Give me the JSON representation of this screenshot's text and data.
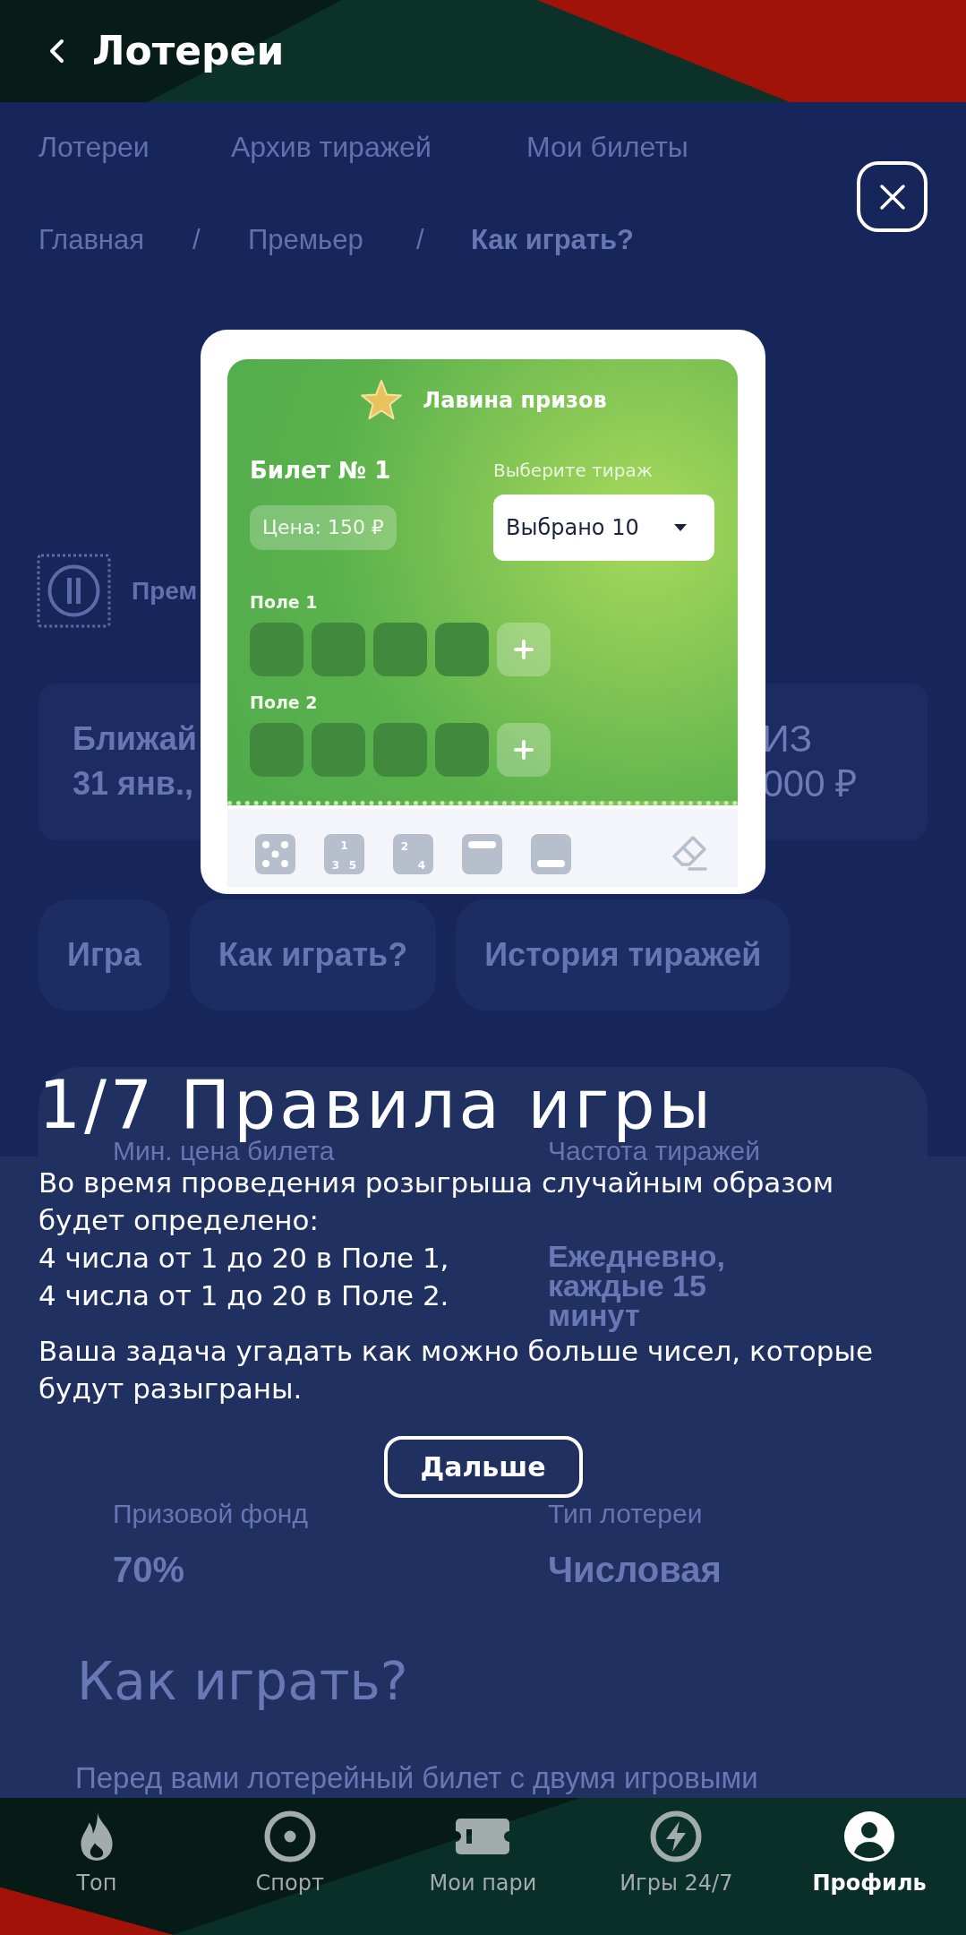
{
  "header": {
    "title": "Лотереи"
  },
  "section_tabs": [
    {
      "label": "Лотереи"
    },
    {
      "label": "Архив тиражей"
    },
    {
      "label": "Мои билеты"
    }
  ],
  "breadcrumbs": [
    {
      "kind": "link",
      "text": "Главная"
    },
    {
      "kind": "separator",
      "text": "/"
    },
    {
      "kind": "link",
      "text": "Премьер"
    },
    {
      "kind": "separator",
      "text": "/"
    },
    {
      "kind": "current",
      "text": "Как играть?"
    }
  ],
  "lottery": {
    "name": "Прем"
  },
  "info_cards": [
    {
      "label": "Ближай",
      "value": "31 янв.,"
    },
    {
      "label": "ИЗ",
      "value": "000 ₽"
    }
  ],
  "page_tabs": [
    {
      "label": "Игра"
    },
    {
      "label": "Как играть?"
    },
    {
      "label": "История тиражей"
    }
  ],
  "stats": [
    {
      "label": "Мин. цена билета"
    },
    {
      "label": "Частота тиражей",
      "value": "Ежедневно, каждые 15 минут"
    },
    {
      "label": "Призовой фонд",
      "value": "70%"
    },
    {
      "label": "Тип лотереи",
      "value": "Числовая"
    }
  ],
  "how_to_play": {
    "title": "Как играть?",
    "text": "Перед вами лотерейный билет с двумя игровыми"
  },
  "ticket": {
    "title": "Лавина призов",
    "number": "Билет № 1",
    "price": "Цена: 150 ₽",
    "draw_label": "Выберите тираж",
    "draw_value": "Выбрано 10",
    "fields": [
      {
        "label": "Поле 1"
      },
      {
        "label": "Поле 2"
      }
    ],
    "tools": [
      {
        "kind": "random"
      },
      {
        "kind": "odd",
        "digits": [
          "1",
          "3",
          "5"
        ]
      },
      {
        "kind": "even",
        "digits": [
          "2",
          "4"
        ]
      },
      {
        "kind": "top"
      },
      {
        "kind": "bottom"
      },
      {
        "kind": "erase"
      }
    ]
  },
  "tutorial": {
    "title": "1/7 Правила игры",
    "paragraphs": [
      {
        "text": "Во время проведения розыгрыша случайным образом будет определено:",
        "lines": [
          "4 числа от 1 до 20 в Поле 1,",
          "4 числа от 1 до 20 в Поле 2."
        ]
      },
      {
        "text": "Ваша задача угадать как можно больше чисел, которые будут разыграны."
      }
    ],
    "button": "Дальше"
  },
  "nav": [
    {
      "label": "Топ",
      "selected": false
    },
    {
      "label": "Спорт",
      "selected": false
    },
    {
      "label": "Мои пари",
      "selected": false
    },
    {
      "label": "Игры 24/7",
      "selected": false
    },
    {
      "label": "Профиль",
      "selected": true
    }
  ]
}
